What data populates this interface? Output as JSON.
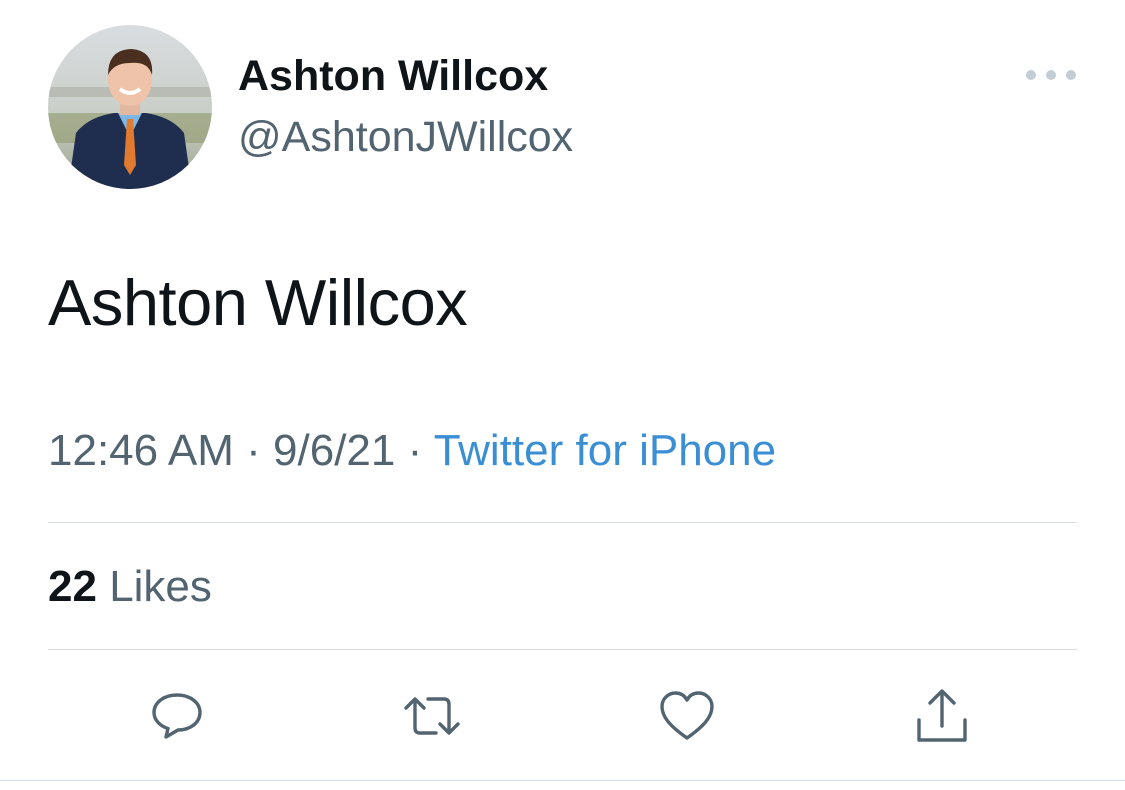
{
  "author": {
    "display_name": "Ashton Willcox",
    "handle": "@AshtonJWillcox",
    "avatar_icon": "profile-photo"
  },
  "tweet": {
    "text": "Ashton Willcox",
    "time": "12:46 AM",
    "separator": "·",
    "date": "9/6/21",
    "source": "Twitter for iPhone"
  },
  "stats": {
    "likes_count": "22",
    "likes_label": "Likes"
  },
  "actions": {
    "reply_icon": "reply-icon",
    "retweet_icon": "retweet-icon",
    "like_icon": "heart-icon",
    "share_icon": "share-icon"
  },
  "colors": {
    "text_primary": "#0f1419",
    "text_secondary": "#536471",
    "link": "#3a8ed3",
    "divider": "#d7dce0",
    "icon": "#536471"
  }
}
